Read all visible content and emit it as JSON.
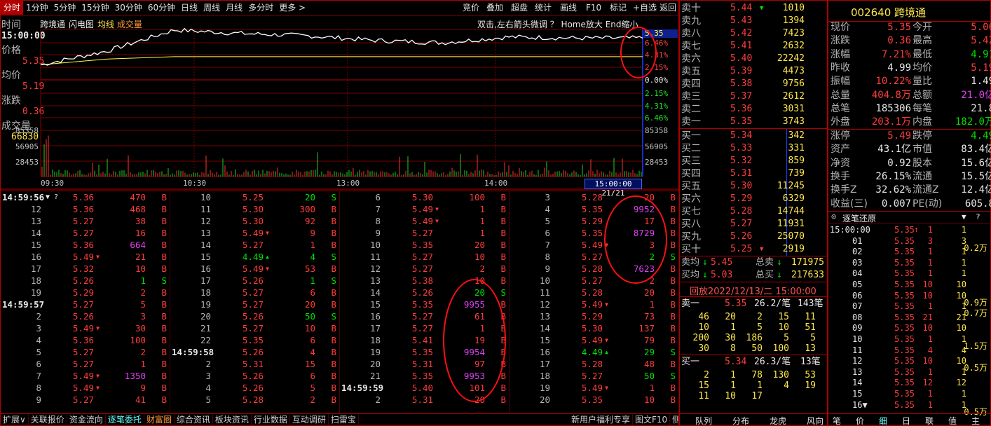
{
  "topbar": {
    "items": [
      "分时",
      "1分钟",
      "5分钟",
      "15分钟",
      "30分钟",
      "60分钟",
      "日线",
      "周线",
      "月线",
      "多分时",
      "更多 >"
    ],
    "right": [
      "竞价",
      "叠加",
      "超盘",
      "统计",
      "画线",
      "F10",
      "标记",
      "+自选",
      "返回"
    ]
  },
  "chart": {
    "time_label": "时间",
    "time_value": "15:00:00",
    "price_label": "价格",
    "price_value": "5.35",
    "avg_label": "均价",
    "avg_value": "5.19",
    "chg_label": "涨跌",
    "chg_value": "0.36",
    "vol_label": "成交量",
    "vol_value": "66830",
    "name": "跨境通",
    "tab1": "闪电图",
    "tab2": "均线",
    "tab3": "成交量",
    "hint": "双击,左右箭头微调 ？   Home放大 End缩小",
    "pct_up": [
      "6.46%",
      "4.31%",
      "2.15%"
    ],
    "pct_zero": "0.00%",
    "pct_down": [
      "2.15%",
      "4.31%",
      "6.46%"
    ],
    "y_top": "5.35",
    "vol_ticks": [
      "85358",
      "56905",
      "28453"
    ],
    "x_ticks": [
      "09:30",
      "10:30",
      "13:00",
      "14:00"
    ],
    "x_end": "15:00:00 21/21",
    "colors": {
      "price": "#ffffff",
      "avg": "#ffff40",
      "grid": "#a00000"
    }
  },
  "chart_data": {
    "type": "line",
    "x": [
      "09:30",
      "10:00",
      "10:30",
      "11:00",
      "11:30",
      "13:00",
      "13:30",
      "14:00",
      "14:30",
      "15:00"
    ],
    "series": [
      {
        "values": [
          5.12,
          5.24,
          5.42,
          5.39,
          5.37,
          5.33,
          5.31,
          5.36,
          5.35,
          5.35
        ]
      },
      {
        "values": [
          5.12,
          5.17,
          5.19,
          5.19,
          5.19,
          5.19,
          5.19,
          5.19,
          5.19,
          5.19
        ]
      }
    ],
    "ylim": [
      4.67,
      5.31
    ]
  },
  "trades": {
    "cols": [
      [
        [
          "14:59:56",
          "5.36",
          "470",
          "B"
        ],
        [
          "12",
          "5.36",
          "468",
          "B"
        ],
        [
          "13",
          "5.27",
          "38",
          "B"
        ],
        [
          "14",
          "5.27",
          "16",
          "B"
        ],
        [
          "15",
          "5.36",
          "664",
          "B"
        ],
        [
          "16",
          "5.49",
          "21",
          "B"
        ],
        [
          "17",
          "5.32",
          "10",
          "B"
        ],
        [
          "18",
          "5.26",
          "1",
          "S"
        ],
        [
          "19",
          "5.29",
          "2",
          "B"
        ],
        [
          "14:59:57",
          "5.27",
          "5",
          "B"
        ],
        [
          "2",
          "5.26",
          "3",
          "B"
        ],
        [
          "3",
          "5.49",
          "30",
          "B"
        ],
        [
          "4",
          "5.36",
          "100",
          "B"
        ],
        [
          "5",
          "5.27",
          "2",
          "B"
        ],
        [
          "6",
          "5.27",
          "1",
          "B"
        ],
        [
          "7",
          "5.49",
          "1350",
          "B"
        ],
        [
          "8",
          "5.49",
          "9",
          "B"
        ],
        [
          "9",
          "5.27",
          "41",
          "B"
        ]
      ],
      [
        [
          "10",
          "5.25",
          "20",
          "S"
        ],
        [
          "11",
          "5.30",
          "300",
          "B"
        ],
        [
          "12",
          "5.30",
          "92",
          "B"
        ],
        [
          "13",
          "5.49",
          "9",
          "B"
        ],
        [
          "14",
          "5.27",
          "1",
          "B"
        ],
        [
          "15",
          "4.49",
          "4",
          "S"
        ],
        [
          "16",
          "5.49",
          "53",
          "B"
        ],
        [
          "17",
          "5.26",
          "1",
          "S"
        ],
        [
          "18",
          "5.27",
          "6",
          "B"
        ],
        [
          "19",
          "5.27",
          "20",
          "B"
        ],
        [
          "20",
          "5.26",
          "50",
          "S"
        ],
        [
          "21",
          "5.27",
          "10",
          "B"
        ],
        [
          "22",
          "5.35",
          "6",
          "B"
        ],
        [
          "14:59:58",
          "5.26",
          "4",
          "B"
        ],
        [
          "2",
          "5.31",
          "15",
          "B"
        ],
        [
          "3",
          "5.26",
          "6",
          "B"
        ],
        [
          "4",
          "5.26",
          "5",
          "B"
        ],
        [
          "5",
          "5.28",
          "2",
          "B"
        ]
      ],
      [
        [
          "6",
          "5.30",
          "100",
          "B"
        ],
        [
          "7",
          "5.49",
          "1",
          "B"
        ],
        [
          "8",
          "5.49",
          "1",
          "B"
        ],
        [
          "9",
          "5.27",
          "1",
          "B"
        ],
        [
          "10",
          "5.35",
          "20",
          "B"
        ],
        [
          "11",
          "5.27",
          "10",
          "B"
        ],
        [
          "12",
          "5.27",
          "2",
          "B"
        ],
        [
          "13",
          "5.38",
          "10",
          "B"
        ],
        [
          "14",
          "5.26",
          "20",
          "S"
        ],
        [
          "15",
          "5.35",
          "9955",
          "B"
        ],
        [
          "16",
          "5.27",
          "61",
          "B"
        ],
        [
          "17",
          "5.27",
          "1",
          "B"
        ],
        [
          "18",
          "5.41",
          "19",
          "B"
        ],
        [
          "19",
          "5.35",
          "9954",
          "B"
        ],
        [
          "20",
          "5.31",
          "97",
          "B"
        ],
        [
          "21",
          "5.35",
          "9953",
          "B"
        ],
        [
          "14:59:59",
          "5.40",
          "101",
          "B"
        ],
        [
          "2",
          "5.31",
          "20",
          "B"
        ]
      ],
      [
        [
          "3",
          "5.28",
          "20",
          "B"
        ],
        [
          "4",
          "5.35",
          "9952",
          "B"
        ],
        [
          "5",
          "5.29",
          "17",
          "B"
        ],
        [
          "6",
          "5.35",
          "8729",
          "B"
        ],
        [
          "7",
          "5.49",
          "3",
          "B"
        ],
        [
          "8",
          "5.27",
          "2",
          "S"
        ],
        [
          "9",
          "5.28",
          "7623",
          "B"
        ],
        [
          "10",
          "5.27",
          "2",
          "B"
        ],
        [
          "11",
          "5.28",
          "20",
          "B"
        ],
        [
          "12",
          "5.49",
          "1",
          "B"
        ],
        [
          "13",
          "5.29",
          "73",
          "B"
        ],
        [
          "14",
          "5.30",
          "137",
          "B"
        ],
        [
          "15",
          "5.49",
          "79",
          "B"
        ],
        [
          "16",
          "4.49",
          "29",
          "S"
        ],
        [
          "17",
          "5.28",
          "48",
          "B"
        ],
        [
          "18",
          "5.27",
          "50",
          "S"
        ],
        [
          "19",
          "5.49",
          "1",
          "B"
        ],
        [
          "20",
          "5.35",
          "10",
          "B"
        ]
      ]
    ]
  },
  "bottombar": [
    "扩展∨",
    "关联报价",
    "资金流向",
    "逐笔委托",
    "财富圈",
    "综合资讯",
    "板块资讯",
    "行业数据",
    "互动调研",
    "扫雷宝",
    "新用户福利专享",
    "图文F10",
    "侧边栏 «"
  ],
  "orderbook": {
    "asks": [
      [
        "卖十",
        "5.44",
        "1010"
      ],
      [
        "卖九",
        "5.43",
        "1394"
      ],
      [
        "卖八",
        "5.42",
        "7423"
      ],
      [
        "卖七",
        "5.41",
        "2632"
      ],
      [
        "卖六",
        "5.40",
        "22242"
      ],
      [
        "卖五",
        "5.39",
        "4473"
      ],
      [
        "卖四",
        "5.38",
        "9756"
      ],
      [
        "卖三",
        "5.37",
        "2612"
      ],
      [
        "卖二",
        "5.36",
        "3031"
      ],
      [
        "卖一",
        "5.35",
        "3743"
      ]
    ],
    "bids": [
      [
        "买一",
        "5.34",
        "342"
      ],
      [
        "买二",
        "5.33",
        "331"
      ],
      [
        "买三",
        "5.32",
        "859"
      ],
      [
        "买四",
        "5.31",
        "739"
      ],
      [
        "买五",
        "5.30",
        "11245"
      ],
      [
        "买六",
        "5.29",
        "6329"
      ],
      [
        "买七",
        "5.28",
        "14744"
      ],
      [
        "买八",
        "5.27",
        "11931"
      ],
      [
        "买九",
        "5.26",
        "25070"
      ],
      [
        "买十",
        "5.25",
        "2919"
      ]
    ],
    "avg_sell_label": "卖均",
    "avg_sell": "5.45",
    "total_sell_label": "总卖",
    "total_sell": "171975",
    "avg_buy_label": "买均",
    "avg_buy": "5.03",
    "total_buy_label": "总买",
    "total_buy": "217633",
    "replay": "回放2022/12/13/二 15:00:00",
    "sell1": {
      "label": "卖一",
      "price": "5.35",
      "avg": "26.2/笔",
      "count": "143笔",
      "grid": [
        [
          "46",
          "20",
          "2",
          "15",
          "11"
        ],
        [
          "10",
          "1",
          "5",
          "10",
          "51"
        ],
        [
          "200",
          "30",
          "186",
          "5",
          "5"
        ],
        [
          "30",
          "8",
          "50",
          "100",
          "13"
        ]
      ]
    },
    "buy1": {
      "label": "买一",
      "price": "5.34",
      "avg": "26.3/笔",
      "count": "13笔",
      "grid": [
        [
          "2",
          "1",
          "78",
          "130",
          "53"
        ],
        [
          "15",
          "1",
          "1",
          "4",
          "19"
        ],
        [
          "11",
          "10",
          "17",
          "",
          ""
        ]
      ]
    },
    "tabs": [
      "队列",
      "分布",
      "龙虎",
      "风向"
    ]
  },
  "info": {
    "code": "002640",
    "name": "跨境通",
    "rows": [
      [
        "现价",
        "5.35",
        "今开",
        "5.06"
      ],
      [
        "涨跌",
        "0.36",
        "最高",
        "5.42"
      ],
      [
        "涨幅",
        "7.21%",
        "最低",
        "4.91"
      ],
      [
        "昨收",
        "4.99",
        "均价",
        "5.19"
      ],
      [
        "振幅",
        "10.22%",
        "量比",
        "1.49"
      ],
      [
        "总量",
        "404.8万",
        "总额",
        "21.0亿"
      ],
      [
        "总笔",
        "185306",
        "每笔",
        "21.8"
      ],
      [
        "外盘",
        "203.1万",
        "内盘",
        "182.0万"
      ]
    ],
    "rows2": [
      [
        "涨停",
        "5.49",
        "跌停",
        "4.49"
      ],
      [
        "资产",
        "43.1亿",
        "市值",
        "83.4亿"
      ],
      [
        "净资",
        "0.92",
        "股本",
        "15.6亿"
      ],
      [
        "换手",
        "26.15%",
        "流通",
        "15.5亿"
      ],
      [
        "换手Z",
        "32.62%",
        "流通Z",
        "12.4亿"
      ],
      [
        "收益(三)",
        "0.007",
        "PE(动)",
        "605.8"
      ]
    ],
    "detail_title": "逐笔还原",
    "detail": [
      [
        "15:00:00",
        "5.35",
        "1",
        "1",
        ""
      ],
      [
        "01",
        "5.35",
        "3",
        "3",
        "0.2万"
      ],
      [
        "02",
        "5.35",
        "1",
        "1",
        ""
      ],
      [
        "03",
        "5.35",
        "1",
        "1",
        ""
      ],
      [
        "04",
        "5.35",
        "1",
        "1",
        ""
      ],
      [
        "05",
        "5.35",
        "10",
        "10",
        ""
      ],
      [
        "06",
        "5.35",
        "10",
        "10",
        "0.9万"
      ],
      [
        "07",
        "5.35",
        "1",
        "1",
        "0.7万"
      ],
      [
        "08",
        "5.35",
        "21",
        "21",
        ""
      ],
      [
        "09",
        "5.35",
        "10",
        "10",
        ""
      ],
      [
        "10",
        "5.35",
        "1",
        "1",
        "1.5万"
      ],
      [
        "11",
        "5.35",
        "4",
        "4",
        ""
      ],
      [
        "12",
        "5.35",
        "10",
        "10",
        "0.5万"
      ],
      [
        "13",
        "5.35",
        "1",
        "1",
        ""
      ],
      [
        "14",
        "5.35",
        "12",
        "12",
        ""
      ],
      [
        "15",
        "5.35",
        "1",
        "1",
        ""
      ],
      [
        "16▼",
        "5.35",
        "1",
        "1",
        "0.5万"
      ]
    ],
    "tabs": [
      "笔",
      "价",
      "细",
      "日",
      "联",
      "值",
      "主"
    ]
  }
}
